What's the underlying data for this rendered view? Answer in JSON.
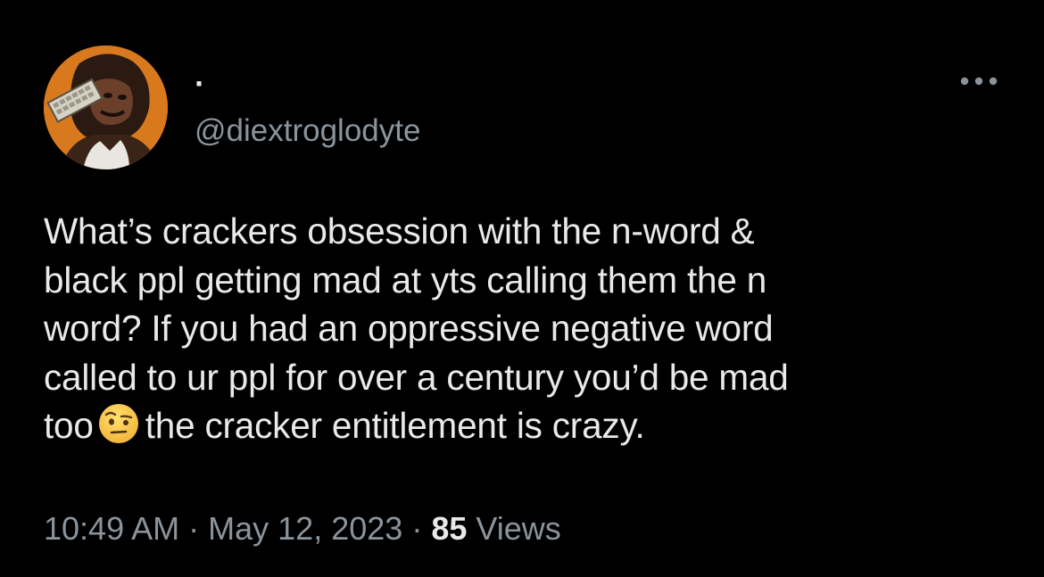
{
  "tweet": {
    "display_name": "·",
    "handle": "@diextroglodyte",
    "text_before_emoji": "What’s crackers obsession with the n-word &\nblack ppl getting mad at yts calling them the n\nword? If you had an oppressive negative word\ncalled to ur ppl for over a century you’d be mad\ntoo",
    "emoji": "face-with-raised-eyebrow-emoji",
    "text_after_emoji": "the cracker entitlement is crazy.",
    "time": "10:49 AM",
    "separator": "·",
    "date": "May 12, 2023",
    "views_count": "85",
    "views_label": "Views"
  },
  "icons": {
    "more": "more-horizontal-icon",
    "avatar": "avatar-caveman-image"
  },
  "colors": {
    "background": "#000000",
    "primary_text": "#e7e9ea",
    "secondary_text": "#8b949b",
    "avatar_bg": "#d9791d"
  }
}
